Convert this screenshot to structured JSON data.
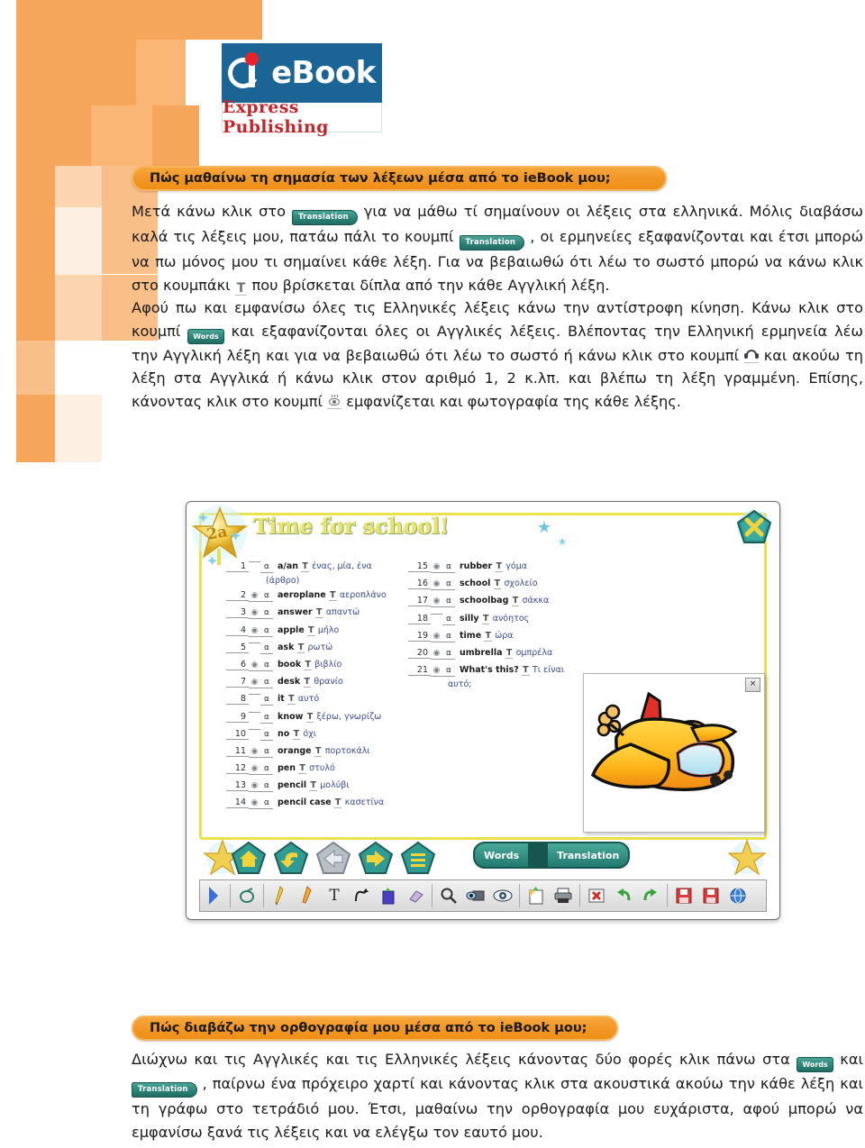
{
  "logo": {
    "icon_name": "ieBook-i-mark",
    "brand": "eBook",
    "publisher": "Express Publishing"
  },
  "section1": {
    "heading": "Πώς μαθαίνω τη σημασία των λέξεων μέσα από το ieBook μου;",
    "p1_a": "Μετά κάνω κλικ στο",
    "btn_translation": "Translation",
    "p1_b": "για να μάθω τί σημαίνουν οι λέξεις στα ελληνικά. Μόλις διαβάσω καλά τις λέξεις μου, πατάω πάλι το κουμπί",
    "p1_c": ", οι ερμηνείες εξαφανίζονται και έτσι μπορώ να πω μόνος μου τι σημαίνει κάθε λέξη. Για να βεβαιωθώ ότι λέω το σωστό μπορώ να κάνω κλικ στο κουμπάκι",
    "btn_T": "T",
    "p1_d": "που βρίσκεται δίπλα από την κάθε Αγγλική λέξη.",
    "p2_a": "Αφού πω και εμφανίσω όλες τις Ελληνικές λέξεις κάνω την αντίστροφη κίνηση. Κάνω κλικ στο κουμπί",
    "btn_words": "Words",
    "p2_b": "και εξαφανίζονται όλες οι Αγγλικές λέξεις. Βλέποντας την Ελληνική ερμηνεία λέω την Αγγλική λέξη και για να βεβαιωθώ ότι λέω το σωστό ή κάνω κλικ στο κουμπί",
    "icon_headphones": "headphones-icon",
    "p2_c": "και ακούω τη λέξη στα Αγγλικά ή κάνω κλικ στον αριθμό 1, 2 κ.λπ. και βλέπω τη λέξη γραμμένη. Επίσης, κάνοντας κλικ στο κουμπί",
    "icon_eye": "eye-icon",
    "p2_d": "εμφανίζεται και φωτογραφία της κάθε λέξης."
  },
  "app": {
    "unit_badge": "2a",
    "title": "Time for school!",
    "close_icon": "close-x-icon",
    "picture_close": "×",
    "picture_alt": "aeroplane-illustration",
    "nav_buttons": [
      {
        "name": "home-button",
        "glyph": "home"
      },
      {
        "name": "back-arrow-button",
        "glyph": "arrow-back"
      },
      {
        "name": "previous-page-button",
        "glyph": "arrow-left"
      },
      {
        "name": "next-page-button",
        "glyph": "arrow-right"
      },
      {
        "name": "contents-button",
        "glyph": "list"
      }
    ],
    "words_label": "Words",
    "translation_label": "Translation",
    "toolbar_tools": [
      "expand-panel-arrow",
      "mouse-pointer-tool",
      "pen-tool",
      "highlighter-tool",
      "text-tool",
      "curve-tool",
      "shape-tool",
      "eraser-tool",
      "zoom-tool",
      "hide-tool",
      "reveal-tool",
      "notepad-tool",
      "print-tool",
      "delete-tool",
      "undo-tool",
      "redo-tool",
      "save-tool",
      "save-as-tool",
      "web-tool"
    ],
    "left_words": [
      {
        "n": "1",
        "eye": false,
        "audio": true,
        "en": "a/an",
        "gr": "ένας, μία, ένα",
        "cont": "(άρθρο)"
      },
      {
        "n": "2",
        "eye": true,
        "audio": true,
        "en": "aeroplane",
        "gr": "αεροπλάνο"
      },
      {
        "n": "3",
        "eye": true,
        "audio": true,
        "en": "answer",
        "gr": "απαντώ"
      },
      {
        "n": "4",
        "eye": true,
        "audio": true,
        "en": "apple",
        "gr": "μήλο"
      },
      {
        "n": "5",
        "eye": false,
        "audio": true,
        "en": "ask",
        "gr": "ρωτώ"
      },
      {
        "n": "6",
        "eye": true,
        "audio": true,
        "en": "book",
        "gr": "βιβλίο"
      },
      {
        "n": "7",
        "eye": true,
        "audio": true,
        "en": "desk",
        "gr": "θρανίο"
      },
      {
        "n": "8",
        "eye": false,
        "audio": true,
        "en": "it",
        "gr": "αυτό"
      },
      {
        "n": "9",
        "eye": false,
        "audio": true,
        "en": "know",
        "gr": "ξέρω, γνωρίζω"
      },
      {
        "n": "10",
        "eye": false,
        "audio": true,
        "en": "no",
        "gr": "όχι"
      },
      {
        "n": "11",
        "eye": true,
        "audio": true,
        "en": "orange",
        "gr": "πορτοκάλι"
      },
      {
        "n": "12",
        "eye": true,
        "audio": true,
        "en": "pen",
        "gr": "στυλό"
      },
      {
        "n": "13",
        "eye": true,
        "audio": true,
        "en": "pencil",
        "gr": "μολύβι"
      },
      {
        "n": "14",
        "eye": true,
        "audio": true,
        "en": "pencil case",
        "gr": "κασετίνα"
      }
    ],
    "right_words": [
      {
        "n": "15",
        "eye": true,
        "audio": true,
        "en": "rubber",
        "gr": "γόμα"
      },
      {
        "n": "16",
        "eye": true,
        "audio": true,
        "en": "school",
        "gr": "σχολείο"
      },
      {
        "n": "17",
        "eye": true,
        "audio": true,
        "en": "schoolbag",
        "gr": "σάκκα"
      },
      {
        "n": "18",
        "eye": false,
        "audio": true,
        "en": "silly",
        "gr": "ανόητος"
      },
      {
        "n": "19",
        "eye": true,
        "audio": true,
        "en": "time",
        "gr": "ώρα"
      },
      {
        "n": "20",
        "eye": true,
        "audio": true,
        "en": "umbrella",
        "gr": "ομπρέλα"
      },
      {
        "n": "21",
        "eye": true,
        "audio": true,
        "en": "What's this?",
        "gr": "Τι είναι",
        "cont": "αυτό;"
      }
    ]
  },
  "section2": {
    "heading": "Πώς διαβάζω την ορθογραφία μου μέσα από το ieBook μου;",
    "p_a": "Διώχνω και τις Αγγλικές και τις Ελληνικές λέξεις κάνοντας δύο φορές κλικ πάνω στα",
    "btn_words": "Words",
    "p_b": "και",
    "btn_translation": "Translation",
    "p_c": ", παίρνω ένα πρόχειρο χαρτί και κάνοντας κλικ στα ακουστικά ακούω την κάθε λέξη και τη γράφω στο τετράδιό μου. Έτσι, μαθαίνω την ορθογραφία μου ευχάριστα, αφού μπορώ να εμφανίσω ξανά τις λέξεις και να ελέγξω τον εαυτό μου."
  },
  "colors": {
    "orange_deco_strong": "#f5a košu",
    "orange_pill": "#f2982a",
    "teal_button": "#2d8377",
    "logo_blue": "#1a6496",
    "logo_red": "#c0272d"
  }
}
